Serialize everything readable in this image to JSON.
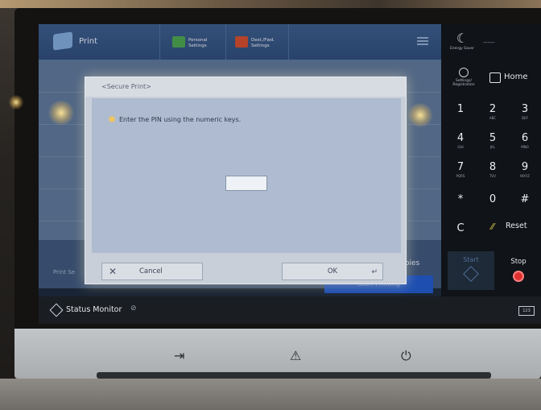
{
  "header": {
    "app_title": "Print",
    "tabs": [
      {
        "label_line1": "Personal",
        "label_line2": "Settings"
      },
      {
        "label_line1": "Dest./Fwd.",
        "label_line2": "Settings"
      }
    ]
  },
  "background": {
    "print_selected": "Print Se",
    "copies_label": "Copies",
    "start_printing_label": "Start Printing"
  },
  "dialog": {
    "title": "<Secure Print>",
    "instruction": "Enter the PIN using the numeric keys.",
    "pin_value": "",
    "cancel_label": "Cancel",
    "ok_label": "OK"
  },
  "status_bar": {
    "status_monitor_label": "Status Monitor",
    "counter_label": "123"
  },
  "keypad": {
    "energy_saver_label": "Energy Saver",
    "top_dash": "-----",
    "settings_label_line1": "Settings/",
    "settings_label_line2": "Registration",
    "home_label": "Home",
    "keys": [
      {
        "num": "1",
        "sub": ""
      },
      {
        "num": "2",
        "sub": "ABC"
      },
      {
        "num": "3",
        "sub": "DEF"
      },
      {
        "num": "4",
        "sub": "GHI"
      },
      {
        "num": "5",
        "sub": "JKL"
      },
      {
        "num": "6",
        "sub": "MNO"
      },
      {
        "num": "7",
        "sub": "PQRS"
      },
      {
        "num": "8",
        "sub": "TUV"
      },
      {
        "num": "9",
        "sub": "WXYZ"
      },
      {
        "num": "*",
        "sub": ""
      },
      {
        "num": "0",
        "sub": ""
      },
      {
        "num": "#",
        "sub": ""
      }
    ],
    "clear_label": "C",
    "reset_label": "Reset",
    "start_label": "Start",
    "stop_label": "Stop"
  },
  "colors": {
    "dialog_bg": "#c9cfd8",
    "appbar": "#2c4a76",
    "start_printing": "#1f57c7",
    "stop": "#e03030"
  },
  "icons": [
    "print-icon",
    "personal-settings-icon",
    "dest-fwd-settings-icon",
    "menu-icon",
    "energy-saver-icon",
    "settings-icon",
    "home-icon",
    "reset-icon",
    "start-icon",
    "stop-icon",
    "status-monitor-icon",
    "counter-icon",
    "info-icon",
    "close-icon",
    "enter-icon"
  ]
}
